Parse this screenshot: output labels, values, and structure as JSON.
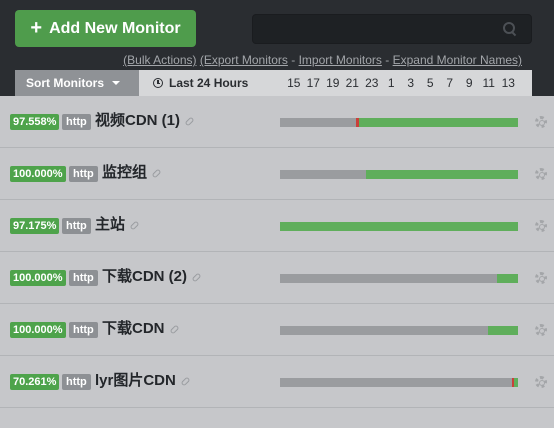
{
  "header": {
    "add_button_label": "Add New Monitor",
    "search_value": "",
    "links": [
      {
        "label": "(Bulk Actions)"
      },
      {
        "label": "(Export Monitors"
      },
      {
        "label": "Import Monitors"
      },
      {
        "label": "Expand Monitor Names)"
      }
    ]
  },
  "toolbar": {
    "sort_label": "Sort Monitors",
    "range_label": "Last 24 Hours",
    "hours": [
      "15",
      "17",
      "19",
      "21",
      "23",
      "1",
      "3",
      "5",
      "7",
      "9",
      "11",
      "13"
    ]
  },
  "colors": {
    "up": "#5fae5b",
    "paused": "#9a9c9f",
    "down": "#c9403a",
    "accent": "#4f9c4c"
  },
  "monitors": [
    {
      "uptime": "97.558%",
      "type": "http",
      "name": "视频CDN (1)",
      "segments": [
        {
          "from": 0,
          "to": 0.32,
          "state": "paused"
        },
        {
          "from": 0.32,
          "to": 0.33,
          "state": "down"
        },
        {
          "from": 0.33,
          "to": 1,
          "state": "up"
        }
      ]
    },
    {
      "uptime": "100.000%",
      "type": "http",
      "name": "监控组",
      "segments": [
        {
          "from": 0,
          "to": 0.36,
          "state": "paused"
        },
        {
          "from": 0.36,
          "to": 1,
          "state": "up"
        }
      ]
    },
    {
      "uptime": "97.175%",
      "type": "http",
      "name": "主站",
      "segments": [
        {
          "from": 0,
          "to": 1,
          "state": "up"
        }
      ]
    },
    {
      "uptime": "100.000%",
      "type": "http",
      "name": "下载CDN (2)",
      "segments": [
        {
          "from": 0,
          "to": 0.91,
          "state": "paused"
        },
        {
          "from": 0.91,
          "to": 1,
          "state": "up"
        }
      ]
    },
    {
      "uptime": "100.000%",
      "type": "http",
      "name": "下载CDN",
      "segments": [
        {
          "from": 0,
          "to": 0.875,
          "state": "paused"
        },
        {
          "from": 0.875,
          "to": 1,
          "state": "up"
        }
      ]
    },
    {
      "uptime": "70.261%",
      "type": "http",
      "name": "lyr图片CDN",
      "segments": [
        {
          "from": 0,
          "to": 0.975,
          "state": "paused"
        },
        {
          "from": 0.975,
          "to": 0.985,
          "state": "down"
        },
        {
          "from": 0.985,
          "to": 1,
          "state": "up"
        }
      ]
    }
  ]
}
